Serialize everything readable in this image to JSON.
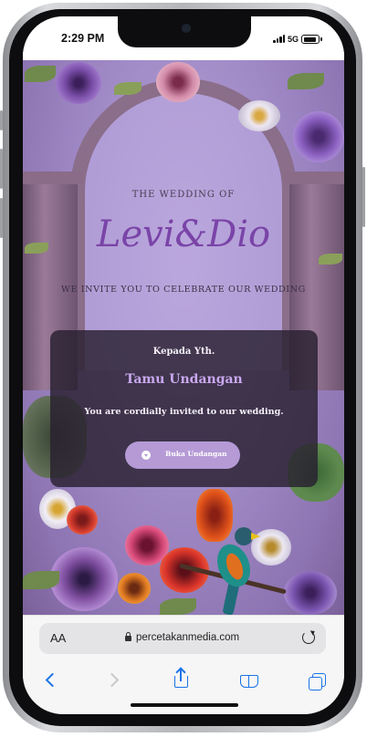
{
  "status_bar": {
    "time": "2:29 PM",
    "network": "5G"
  },
  "invitation": {
    "heading": "THE WEDDING OF",
    "couple_names": "Levi&Dio",
    "invite_text": "WE INVITE YOU TO CELEBRATE OUR WEDDING",
    "addressee_label": "Kepada Yth.",
    "guest_name": "Tamu Undangan",
    "message": "You are cordially invited to our wedding.",
    "open_button_label": "Buka Undangan",
    "accent_color": "#7a44a8"
  },
  "browser": {
    "text_size_label": "AA",
    "domain": "percetakanmedia.com",
    "icons": [
      "text-size-icon",
      "lock-icon",
      "reload-icon",
      "back-icon",
      "forward-icon",
      "share-icon",
      "bookmarks-icon",
      "tabs-icon"
    ]
  }
}
